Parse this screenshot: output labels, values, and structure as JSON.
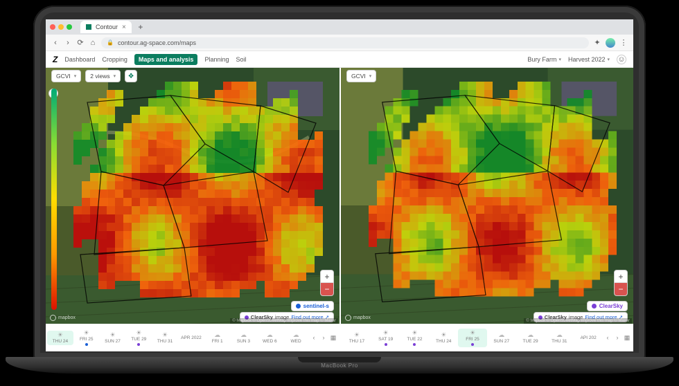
{
  "browser": {
    "tab_title": "Contour",
    "url": "contour.ag-space.com/maps"
  },
  "app": {
    "brand_glyph": "Z",
    "nav": [
      "Dashboard",
      "Cropping",
      "Maps and analysis",
      "Planning",
      "Soil"
    ],
    "active_nav": "Maps and analysis",
    "farm": "Bury Farm",
    "harvest": "Harvest 2022"
  },
  "toolbar_left": {
    "index_select": "GCVI",
    "views_select": "2 views",
    "layers_icon": "layers-icon"
  },
  "toolbar_right": {
    "index_select": "GCVI"
  },
  "panels": [
    {
      "source_badge": "sentinel-s",
      "source_color": "#1a5fd6",
      "info_prefix": "ClearSky",
      "info_text": "image",
      "info_link": "Find out more",
      "timeline": [
        {
          "label": "THU 24",
          "sel": true,
          "icon": "sun",
          "dot": ""
        },
        {
          "label": "FRI 25",
          "icon": "sun",
          "dot": "#1a5fd6"
        },
        {
          "label": "SUN 27",
          "icon": "sun",
          "dot": ""
        },
        {
          "label": "TUE 29",
          "icon": "sun",
          "dot": "#7a3fd6"
        },
        {
          "label": "THU 31",
          "icon": "sun",
          "dot": ""
        },
        {
          "label": "APR 2022",
          "icon": "",
          "dot": ""
        },
        {
          "label": "FRI 1",
          "icon": "cloud",
          "dot": ""
        },
        {
          "label": "SUN 3",
          "icon": "cloud",
          "dot": ""
        },
        {
          "label": "WED 6",
          "icon": "cloud",
          "dot": ""
        },
        {
          "label": "WED",
          "icon": "cloud",
          "dot": ""
        }
      ]
    },
    {
      "source_badge": "ClearSky",
      "source_color": "#7a3fd6",
      "info_prefix": "ClearSky",
      "info_text": "image",
      "info_link": "Find out more",
      "timeline": [
        {
          "label": "THU 17",
          "icon": "sun",
          "dot": ""
        },
        {
          "label": "SAT 19",
          "icon": "sun",
          "dot": "#7a3fd6"
        },
        {
          "label": "TUE 22",
          "icon": "sun",
          "dot": "#7a3fd6"
        },
        {
          "label": "THU 24",
          "icon": "sun",
          "dot": ""
        },
        {
          "label": "FRI 25",
          "sel": true,
          "icon": "sun",
          "dot": "#7a3fd6"
        },
        {
          "label": "SUN 27",
          "icon": "cloud",
          "dot": ""
        },
        {
          "label": "TUE 29",
          "icon": "cloud",
          "dot": ""
        },
        {
          "label": "THU 31",
          "icon": "cloud",
          "dot": ""
        },
        {
          "label": "API 202",
          "icon": "",
          "dot": ""
        }
      ]
    }
  ],
  "mapbox_label": "mapbox",
  "attribution": "© Mapbox © OpenStreetMap Improve this map © Maxar",
  "laptop_brand": "MacBook Pro"
}
